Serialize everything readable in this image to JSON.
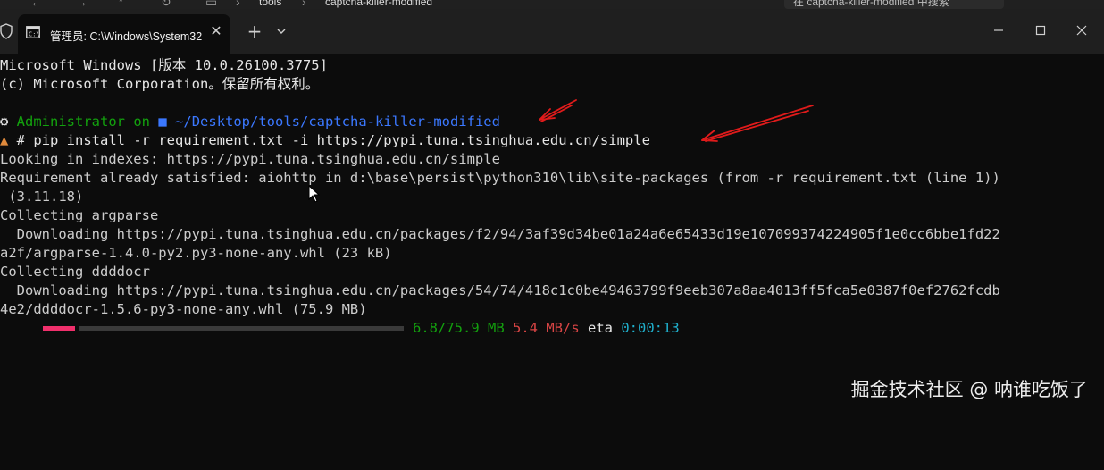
{
  "explorer": {
    "breadcrumb": [
      "tools",
      "captcha-killer-modified"
    ],
    "search_text": "在 captcha-killer-modified 中搜索"
  },
  "window": {
    "tab_title": "管理员: C:\\Windows\\System32",
    "tab_close": "✕",
    "new_tab": "+",
    "minimize": "minimize",
    "maximize": "maximize",
    "close": "close"
  },
  "terminal": {
    "banner_line1": "Microsoft Windows [版本 10.0.26100.3775]",
    "banner_line2": "(c) Microsoft Corporation。保留所有权利。",
    "prompt_user": "Administrator",
    "prompt_on": "on",
    "prompt_path": "~/Desktop/tools/captcha-killer-modified",
    "prompt_symbol": "#",
    "command": "pip install -r requirement.txt -i https://pypi.tuna.tsinghua.edu.cn/simple",
    "output": [
      "Looking in indexes: https://pypi.tuna.tsinghua.edu.cn/simple",
      "Requirement already satisfied: aiohttp in d:\\base\\persist\\python310\\lib\\site-packages (from -r requirement.txt (line 1))",
      " (3.11.18)",
      "Collecting argparse",
      "  Downloading https://pypi.tuna.tsinghua.edu.cn/packages/f2/94/3af39d34be01a24a6e65433d19e107099374224905f1e0cc6bbe1fd22",
      "a2f/argparse-1.4.0-py2.py3-none-any.whl (23 kB)",
      "Collecting ddddocr",
      "  Downloading https://pypi.tuna.tsinghua.edu.cn/packages/54/74/418c1c0be49463799f9eeb307a8aa4013ff5fca5e0387f0ef2762fcdb",
      "4e2/ddddocr-1.5.6-py3-none-any.whl (75.9 MB)"
    ],
    "progress": {
      "fraction": 0.0896,
      "size": "6.8/75.9 MB",
      "speed": "5.4 MB/s",
      "eta_label": "eta",
      "eta": "0:00:13"
    }
  },
  "watermark": "掘金技术社区 @ 呐谁吃饭了",
  "colors": {
    "prompt_user": "#13a10e",
    "prompt_path": "#3b78ff",
    "progress_fill": "#f0306c",
    "annotation_arrow": "#e01b1b"
  }
}
